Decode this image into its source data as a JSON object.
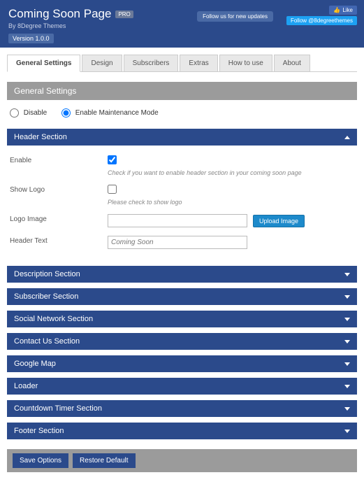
{
  "header": {
    "title": "Coming Soon Page",
    "pro_badge": "PRO",
    "byline": "By 8Degree Themes",
    "version": "Version 1.0.0",
    "follow_btn": "Follow us for new updates",
    "fb_like": "Like",
    "tw_follow": "Follow @8degreethemes"
  },
  "tabs": [
    {
      "label": "General Settings",
      "active": true
    },
    {
      "label": "Design",
      "active": false
    },
    {
      "label": "Subscribers",
      "active": false
    },
    {
      "label": "Extras",
      "active": false
    },
    {
      "label": "How to use",
      "active": false
    },
    {
      "label": "About",
      "active": false
    }
  ],
  "panel_title": "General Settings",
  "mode": {
    "disable": "Disable",
    "enable": "Enable Maintenance Mode",
    "selected": "enable"
  },
  "sections": {
    "header": {
      "title": "Header Section",
      "expanded": true,
      "fields": {
        "enable": {
          "label": "Enable",
          "checked": true,
          "hint": "Check if you want to enable header section in your coming soon page"
        },
        "show_logo": {
          "label": "Show Logo",
          "checked": false,
          "hint": "Please check to show logo"
        },
        "logo_image": {
          "label": "Logo Image",
          "value": "",
          "upload_btn": "Upload Image"
        },
        "header_text": {
          "label": "Header Text",
          "placeholder": "Coming Soon"
        }
      }
    },
    "description": {
      "title": "Description Section"
    },
    "subscriber": {
      "title": "Subscriber Section"
    },
    "social": {
      "title": "Social Network Section"
    },
    "contact": {
      "title": "Contact Us Section"
    },
    "map": {
      "title": "Google Map"
    },
    "loader": {
      "title": "Loader"
    },
    "countdown": {
      "title": "Countdown Timer Section"
    },
    "footer": {
      "title": "Footer Section"
    }
  },
  "actions": {
    "save": "Save Options",
    "restore": "Restore Default"
  }
}
